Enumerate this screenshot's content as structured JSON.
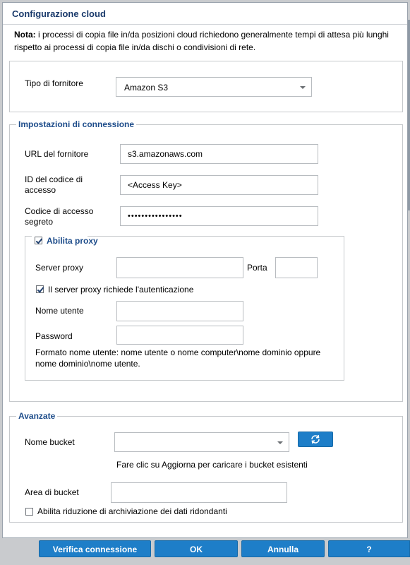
{
  "dialog": {
    "title": "Configurazione cloud",
    "note_label": "Nota:",
    "note_text": " i processi di copia file in/da posizioni cloud richiedono generalmente tempi di attesa più lunghi rispetto ai processi di copia file in/da dischi o condivisioni di rete."
  },
  "provider": {
    "label": "Tipo di fornitore",
    "selected": "Amazon S3"
  },
  "connection": {
    "legend": "Impostazioni di connessione",
    "url_label": "URL del fornitore",
    "url_value": "s3.amazonaws.com",
    "access_id_label": "ID del codice di accesso",
    "access_id_value": "<Access Key>",
    "secret_label": "Codice di accesso segreto",
    "secret_value": "••••••••••••••••"
  },
  "proxy": {
    "enable_label": "Abilita proxy",
    "enable_checked": true,
    "server_label": "Server proxy",
    "server_value": "",
    "port_label": "Porta",
    "port_value": "",
    "auth_label": "Il server proxy richiede l'autenticazione",
    "auth_checked": true,
    "username_label": "Nome utente",
    "username_value": "",
    "password_label": "Password",
    "password_value": "",
    "format_hint": "Formato nome utente: nome utente o nome computer\\nome dominio oppure nome dominio\\nome utente."
  },
  "advanced": {
    "legend": "Avanzate",
    "bucket_label": "Nome bucket",
    "bucket_value": "",
    "bucket_hint": "Fare clic su Aggiorna per caricare i bucket esistenti",
    "area_label": "Area di bucket",
    "area_value": "",
    "rrs_label": "Abilita riduzione di archiviazione dei dati ridondanti",
    "rrs_checked": false
  },
  "buttons": {
    "verify": "Verifica connessione",
    "ok": "OK",
    "cancel": "Annulla",
    "help": "?"
  },
  "icons": {
    "refresh": "refresh-icon"
  },
  "colors": {
    "accent": "#1e7ec8",
    "legend": "#1d4c8a",
    "title": "#1a3a6b"
  }
}
